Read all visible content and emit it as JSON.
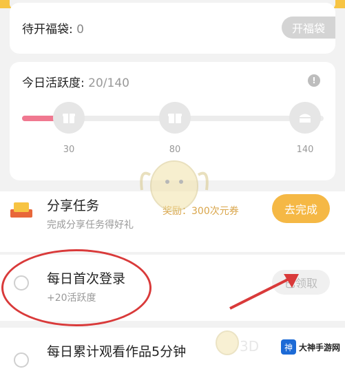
{
  "bags": {
    "label": "待开福袋:",
    "count": "0",
    "open_label": "开福袋"
  },
  "activity": {
    "label": "今日活跃度:",
    "value": "20/140",
    "progress_fraction": 0.14,
    "milestones": [
      "30",
      "80",
      "140"
    ]
  },
  "tasks": {
    "share": {
      "title": "分享任务",
      "subtitle": "完成分享任务得好礼",
      "reward": "奖励：300次元券",
      "action": "去完成"
    },
    "login": {
      "title": "每日首次登录",
      "subtitle": "+20活跃度",
      "action": "已领取"
    },
    "watch": {
      "title": "每日累计观看作品5分钟"
    }
  },
  "watermark": {
    "text": "3D"
  },
  "site_badge": {
    "logo_text": "神",
    "name": "大神手游网"
  },
  "colors": {
    "accent": "#f5b845",
    "progress": "#f07890",
    "highlight": "#d93a3a"
  }
}
